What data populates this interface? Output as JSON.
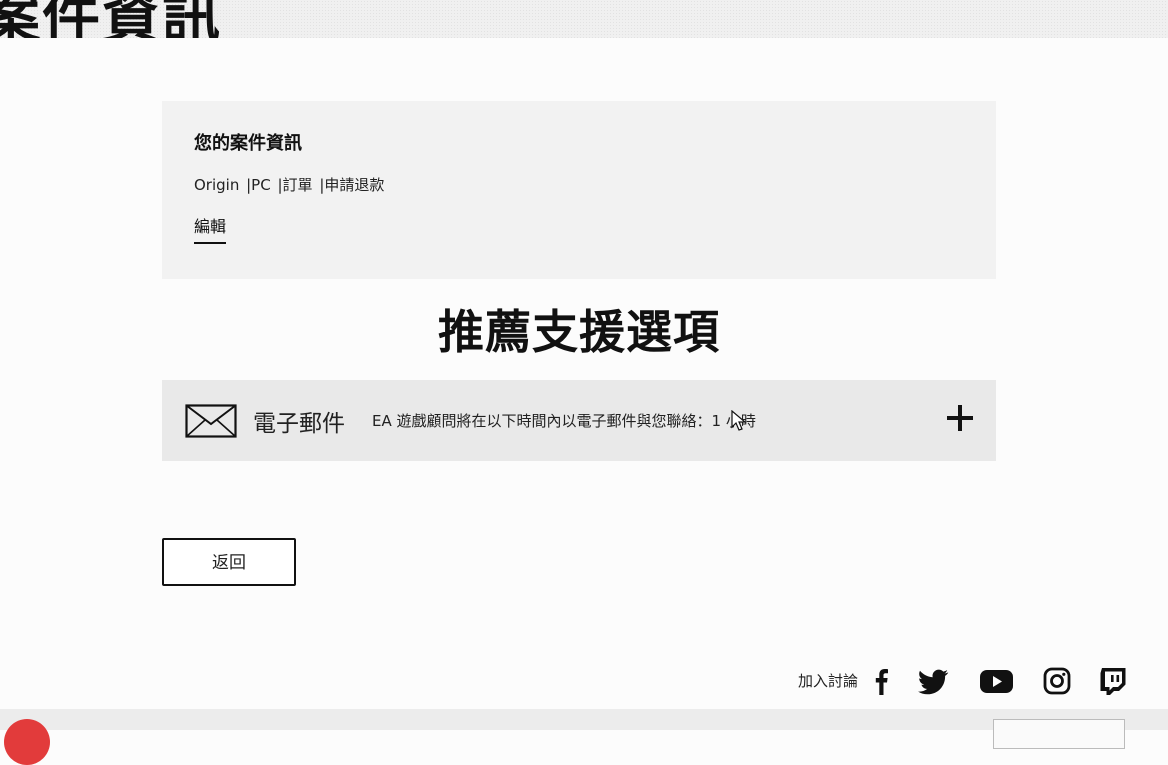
{
  "header": {
    "title_fragment": "案件資訊"
  },
  "case_info": {
    "heading": "您的案件資訊",
    "meta": [
      "Origin",
      "|PC",
      "|訂單",
      "|申請退款"
    ],
    "edit_label": "編輯"
  },
  "support": {
    "title": "推薦支援選項",
    "email": {
      "icon": "mail-icon",
      "label": "電子郵件",
      "description": "EA 遊戲顧問將在以下時間內以電子郵件與您聯絡：1 小時",
      "expand_icon": "plus-icon"
    }
  },
  "back_label": "返回",
  "footer": {
    "join_label": "加入討論",
    "social_icons": [
      "facebook-icon",
      "twitter-icon",
      "youtube-icon",
      "instagram-icon",
      "twitch-icon"
    ]
  },
  "colors": {
    "accent_bottom": "#e23b3b",
    "card_bg": "#f2f2f2",
    "row_bg": "#e9e9e9"
  }
}
